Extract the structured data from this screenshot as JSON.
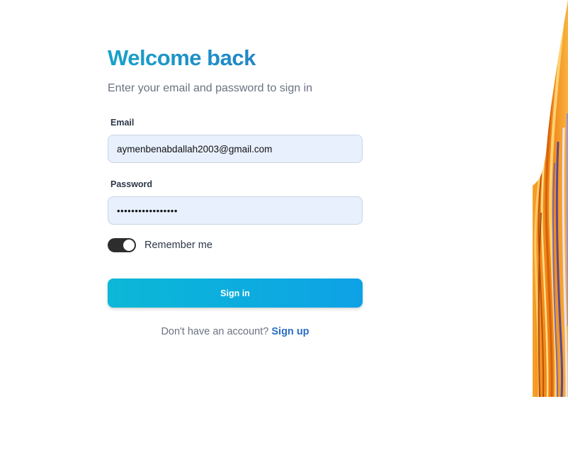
{
  "login": {
    "title": "Welcome back",
    "subtitle": "Enter your email and password to sign in",
    "email": {
      "label": "Email",
      "value": "aymenbenabdallah2003@gmail.com"
    },
    "password": {
      "label": "Password",
      "value": "•••••••••••••••••"
    },
    "remember": {
      "label": "Remember me",
      "checked": true
    },
    "signin_label": "Sign in",
    "signup_prompt": "Don't have an account?",
    "signup_link": "Sign up"
  },
  "colors": {
    "title_gradient_start": "#17a2c9",
    "title_gradient_end": "#2b6fc4",
    "button_gradient_start": "#0cb8d6",
    "button_gradient_end": "#0da2e6",
    "input_background": "#e8f0fe",
    "link": "#2b6fc4",
    "toggle_on": "#2d2d2d"
  },
  "icons": {
    "side_art": "orange-swirl-image"
  }
}
